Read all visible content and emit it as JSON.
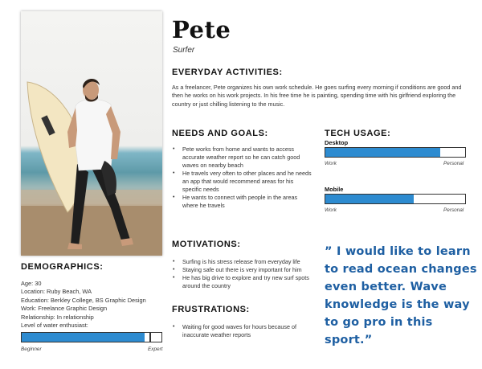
{
  "persona": {
    "name": "Pete",
    "role": "Surfer"
  },
  "everyday": {
    "heading": "EVERYDAY ACTIVITIES:",
    "text": "As a freelancer, Pete organizes his own work schedule. He goes surfing every morning if conditions are good and then he works on his work projects. In his free time he is painting, spending time with his girlfriend exploring the country or just chilling listening to the music."
  },
  "needs": {
    "heading": "NEEDS AND GOALS:",
    "items": [
      "Pete works from home and wants to access accurate weather report so he can catch good waves on nearby beach",
      "He travels very often to other places and he needs an app that would recommend areas for his specific needs",
      "He wants to connect with people in the areas where he travels"
    ]
  },
  "tech": {
    "heading": "TECH USAGE:",
    "bars": [
      {
        "label": "Desktop",
        "value": 0.82,
        "left_label": "Work",
        "right_label": "Personal"
      },
      {
        "label": "Mobile",
        "value": 0.63,
        "left_label": "Work",
        "right_label": "Personal"
      }
    ]
  },
  "motivations": {
    "heading": "MOTIVATIONS:",
    "items": [
      "Surfing is his stress release from everyday life",
      "Staying safe out there is very important for him",
      "He has big drive to explore and try new surf spots around the country"
    ]
  },
  "frustrations": {
    "heading": "FRUSTRATIONS:",
    "items": [
      "Waiting for good waves for hours because of inaccurate weather reports"
    ]
  },
  "demographics": {
    "heading": "DEMOGRAPHICS:",
    "age": "Age:  30",
    "location": "Location:  Ruby Beach, WA",
    "education": "Education:  Berkley College, BS Graphic Design",
    "work": "Work: Freelance Graphic Design",
    "relationship": "Relationship:  In relationship",
    "level_label": "Level of water enthusiast:",
    "level_value": 0.88,
    "level_left": "Beginner",
    "level_right": "Expert"
  },
  "quote": "” I would like to learn to read ocean changes even better. Wave knowledge is the way to go pro in this sport.”",
  "colors": {
    "accent": "#2d8bd0",
    "quote": "#1e5fa2"
  },
  "photo": {
    "subject": "surfer-with-surfboard"
  }
}
